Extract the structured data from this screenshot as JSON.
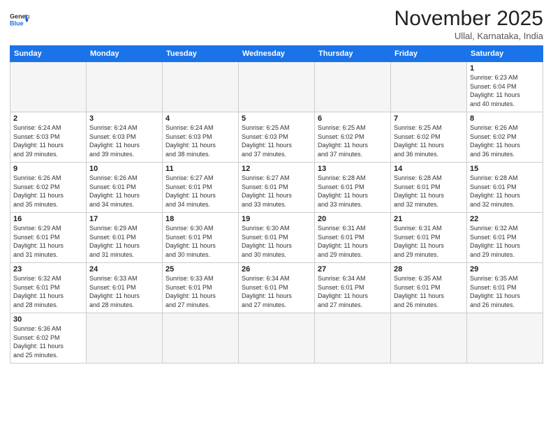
{
  "header": {
    "logo_general": "General",
    "logo_blue": "Blue",
    "month_title": "November 2025",
    "subtitle": "Ullal, Karnataka, India"
  },
  "days_of_week": [
    "Sunday",
    "Monday",
    "Tuesday",
    "Wednesday",
    "Thursday",
    "Friday",
    "Saturday"
  ],
  "weeks": [
    [
      {
        "day": "",
        "info": ""
      },
      {
        "day": "",
        "info": ""
      },
      {
        "day": "",
        "info": ""
      },
      {
        "day": "",
        "info": ""
      },
      {
        "day": "",
        "info": ""
      },
      {
        "day": "",
        "info": ""
      },
      {
        "day": "1",
        "info": "Sunrise: 6:23 AM\nSunset: 6:04 PM\nDaylight: 11 hours\nand 40 minutes."
      }
    ],
    [
      {
        "day": "2",
        "info": "Sunrise: 6:24 AM\nSunset: 6:03 PM\nDaylight: 11 hours\nand 39 minutes."
      },
      {
        "day": "3",
        "info": "Sunrise: 6:24 AM\nSunset: 6:03 PM\nDaylight: 11 hours\nand 39 minutes."
      },
      {
        "day": "4",
        "info": "Sunrise: 6:24 AM\nSunset: 6:03 PM\nDaylight: 11 hours\nand 38 minutes."
      },
      {
        "day": "5",
        "info": "Sunrise: 6:25 AM\nSunset: 6:03 PM\nDaylight: 11 hours\nand 37 minutes."
      },
      {
        "day": "6",
        "info": "Sunrise: 6:25 AM\nSunset: 6:02 PM\nDaylight: 11 hours\nand 37 minutes."
      },
      {
        "day": "7",
        "info": "Sunrise: 6:25 AM\nSunset: 6:02 PM\nDaylight: 11 hours\nand 36 minutes."
      },
      {
        "day": "8",
        "info": "Sunrise: 6:26 AM\nSunset: 6:02 PM\nDaylight: 11 hours\nand 36 minutes."
      }
    ],
    [
      {
        "day": "9",
        "info": "Sunrise: 6:26 AM\nSunset: 6:02 PM\nDaylight: 11 hours\nand 35 minutes."
      },
      {
        "day": "10",
        "info": "Sunrise: 6:26 AM\nSunset: 6:01 PM\nDaylight: 11 hours\nand 34 minutes."
      },
      {
        "day": "11",
        "info": "Sunrise: 6:27 AM\nSunset: 6:01 PM\nDaylight: 11 hours\nand 34 minutes."
      },
      {
        "day": "12",
        "info": "Sunrise: 6:27 AM\nSunset: 6:01 PM\nDaylight: 11 hours\nand 33 minutes."
      },
      {
        "day": "13",
        "info": "Sunrise: 6:28 AM\nSunset: 6:01 PM\nDaylight: 11 hours\nand 33 minutes."
      },
      {
        "day": "14",
        "info": "Sunrise: 6:28 AM\nSunset: 6:01 PM\nDaylight: 11 hours\nand 32 minutes."
      },
      {
        "day": "15",
        "info": "Sunrise: 6:28 AM\nSunset: 6:01 PM\nDaylight: 11 hours\nand 32 minutes."
      }
    ],
    [
      {
        "day": "16",
        "info": "Sunrise: 6:29 AM\nSunset: 6:01 PM\nDaylight: 11 hours\nand 31 minutes."
      },
      {
        "day": "17",
        "info": "Sunrise: 6:29 AM\nSunset: 6:01 PM\nDaylight: 11 hours\nand 31 minutes."
      },
      {
        "day": "18",
        "info": "Sunrise: 6:30 AM\nSunset: 6:01 PM\nDaylight: 11 hours\nand 30 minutes."
      },
      {
        "day": "19",
        "info": "Sunrise: 6:30 AM\nSunset: 6:01 PM\nDaylight: 11 hours\nand 30 minutes."
      },
      {
        "day": "20",
        "info": "Sunrise: 6:31 AM\nSunset: 6:01 PM\nDaylight: 11 hours\nand 29 minutes."
      },
      {
        "day": "21",
        "info": "Sunrise: 6:31 AM\nSunset: 6:01 PM\nDaylight: 11 hours\nand 29 minutes."
      },
      {
        "day": "22",
        "info": "Sunrise: 6:32 AM\nSunset: 6:01 PM\nDaylight: 11 hours\nand 29 minutes."
      }
    ],
    [
      {
        "day": "23",
        "info": "Sunrise: 6:32 AM\nSunset: 6:01 PM\nDaylight: 11 hours\nand 28 minutes."
      },
      {
        "day": "24",
        "info": "Sunrise: 6:33 AM\nSunset: 6:01 PM\nDaylight: 11 hours\nand 28 minutes."
      },
      {
        "day": "25",
        "info": "Sunrise: 6:33 AM\nSunset: 6:01 PM\nDaylight: 11 hours\nand 27 minutes."
      },
      {
        "day": "26",
        "info": "Sunrise: 6:34 AM\nSunset: 6:01 PM\nDaylight: 11 hours\nand 27 minutes."
      },
      {
        "day": "27",
        "info": "Sunrise: 6:34 AM\nSunset: 6:01 PM\nDaylight: 11 hours\nand 27 minutes."
      },
      {
        "day": "28",
        "info": "Sunrise: 6:35 AM\nSunset: 6:01 PM\nDaylight: 11 hours\nand 26 minutes."
      },
      {
        "day": "29",
        "info": "Sunrise: 6:35 AM\nSunset: 6:01 PM\nDaylight: 11 hours\nand 26 minutes."
      }
    ],
    [
      {
        "day": "30",
        "info": "Sunrise: 6:36 AM\nSunset: 6:02 PM\nDaylight: 11 hours\nand 25 minutes."
      },
      {
        "day": "",
        "info": ""
      },
      {
        "day": "",
        "info": ""
      },
      {
        "day": "",
        "info": ""
      },
      {
        "day": "",
        "info": ""
      },
      {
        "day": "",
        "info": ""
      },
      {
        "day": "",
        "info": ""
      }
    ]
  ]
}
